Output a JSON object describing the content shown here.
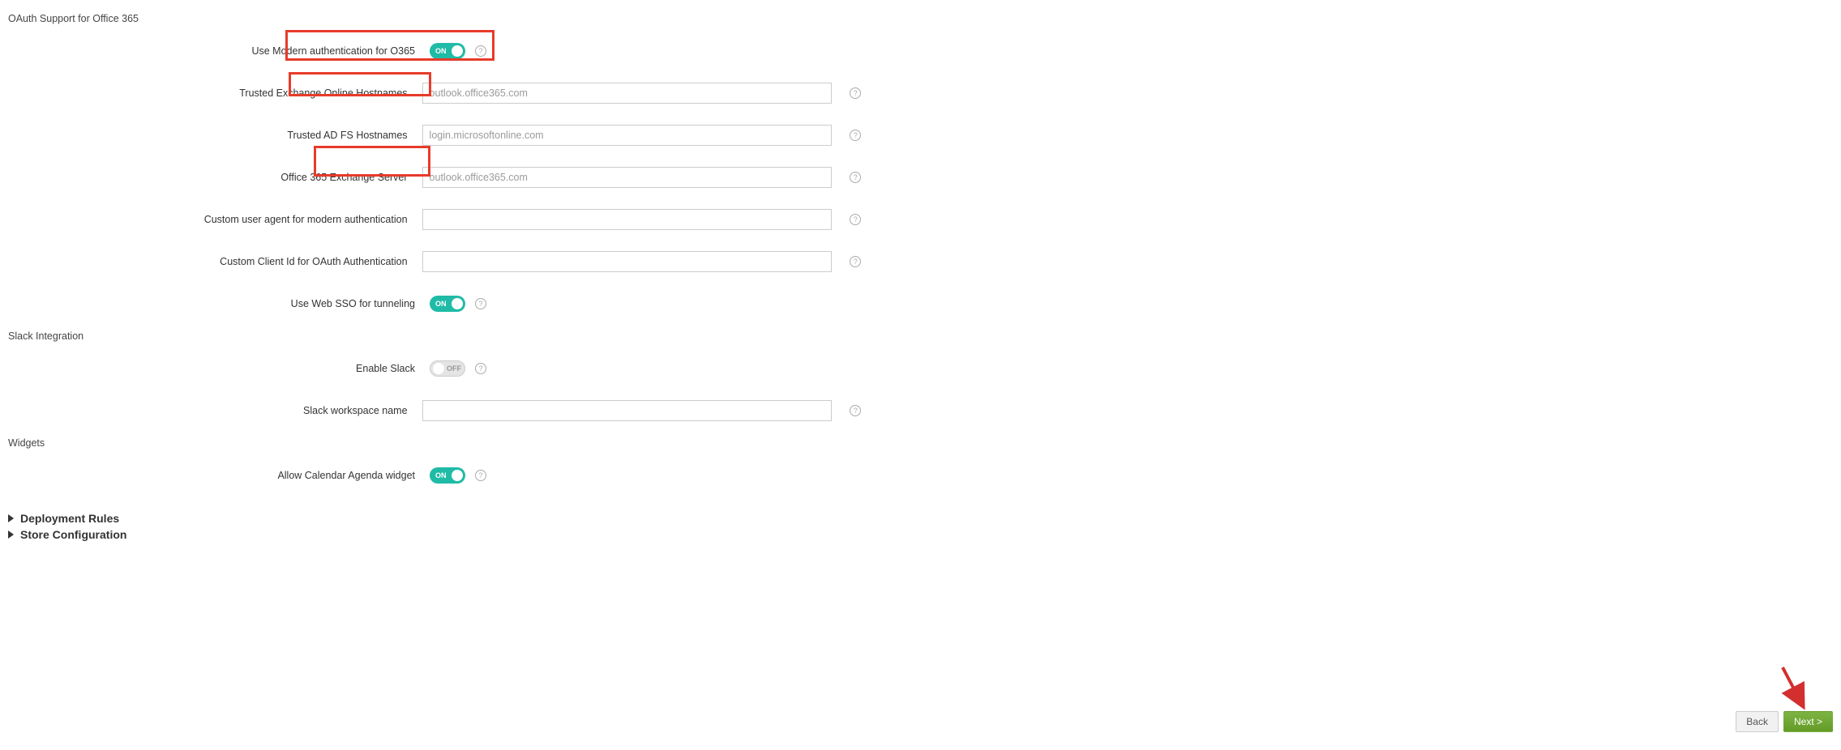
{
  "section_oauth": "OAuth Support for Office 365",
  "labels": {
    "modern_auth": "Use Modern authentication for O365",
    "trusted_hostnames": "Trusted Exchange Online Hostnames",
    "adfs_hostnames": "Trusted AD FS Hostnames",
    "exchange_server": "Office 365 Exchange Server",
    "user_agent": "Custom user agent for modern authentication",
    "client_id": "Custom Client Id for OAuth Authentication",
    "web_sso": "Use Web SSO for tunneling"
  },
  "placeholders": {
    "trusted_hostnames": "outlook.office365.com",
    "adfs_hostnames": "login.microsoftonline.com",
    "exchange_server": "outlook.office365.com"
  },
  "toggles": {
    "on_text": "ON",
    "off_text": "OFF"
  },
  "section_slack": "Slack Integration",
  "slack": {
    "enable_label": "Enable Slack",
    "workspace_label": "Slack workspace name"
  },
  "section_widgets": "Widgets",
  "widgets": {
    "calendar_label": "Allow Calendar Agenda widget"
  },
  "collapsed": {
    "deployment": "Deployment Rules",
    "store": "Store Configuration"
  },
  "buttons": {
    "back": "Back",
    "next": "Next >"
  }
}
